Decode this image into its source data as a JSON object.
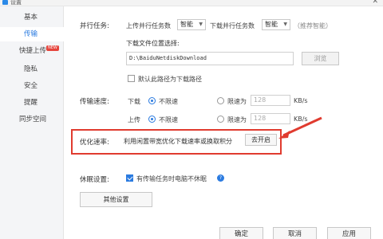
{
  "window": {
    "title": "设置",
    "close_glyph": "✕"
  },
  "sidebar": {
    "items": [
      {
        "label": "基本"
      },
      {
        "label": "传输"
      },
      {
        "label": "快捷上传"
      },
      {
        "label": "隐私"
      },
      {
        "label": "安全"
      },
      {
        "label": "提醒"
      },
      {
        "label": "同步空间"
      }
    ],
    "new_badge": "NEW"
  },
  "parallel": {
    "label": "并行任务:",
    "upload_label": "上传并行任务数",
    "upload_value": "智能",
    "download_label": "下载并行任务数",
    "download_value": "智能",
    "hint": "（推荐智能）"
  },
  "download_path": {
    "label": "下载文件位置选择:",
    "value": "D:\\BaiduNetdiskDownload",
    "browse_button": "浏览",
    "default_checkbox_label": "默认此路径为下载路径"
  },
  "speed": {
    "label": "传输速度:",
    "download": {
      "row_label": "下载",
      "unlimited": "不限速",
      "limit": "限速为",
      "value": "128",
      "unit": "KB/s"
    },
    "upload": {
      "row_label": "上传",
      "unlimited": "不限速",
      "limit": "限速为",
      "value": "128",
      "unit": "KB/s"
    }
  },
  "optimize": {
    "label": "优化速率:",
    "description": "利用闲置带宽优化下载速率或换取积分",
    "button": "去开启"
  },
  "sleep": {
    "label": "休眠设置:",
    "checkbox_label": "有传输任务时电脑不休眠",
    "help_glyph": "?"
  },
  "other_settings_button": "其他设置",
  "footer": {
    "ok": "确定",
    "cancel": "取消",
    "apply": "应用"
  },
  "colors": {
    "accent": "#2b7be0",
    "highlight": "#e03b2f",
    "badge": "#e5443c"
  }
}
